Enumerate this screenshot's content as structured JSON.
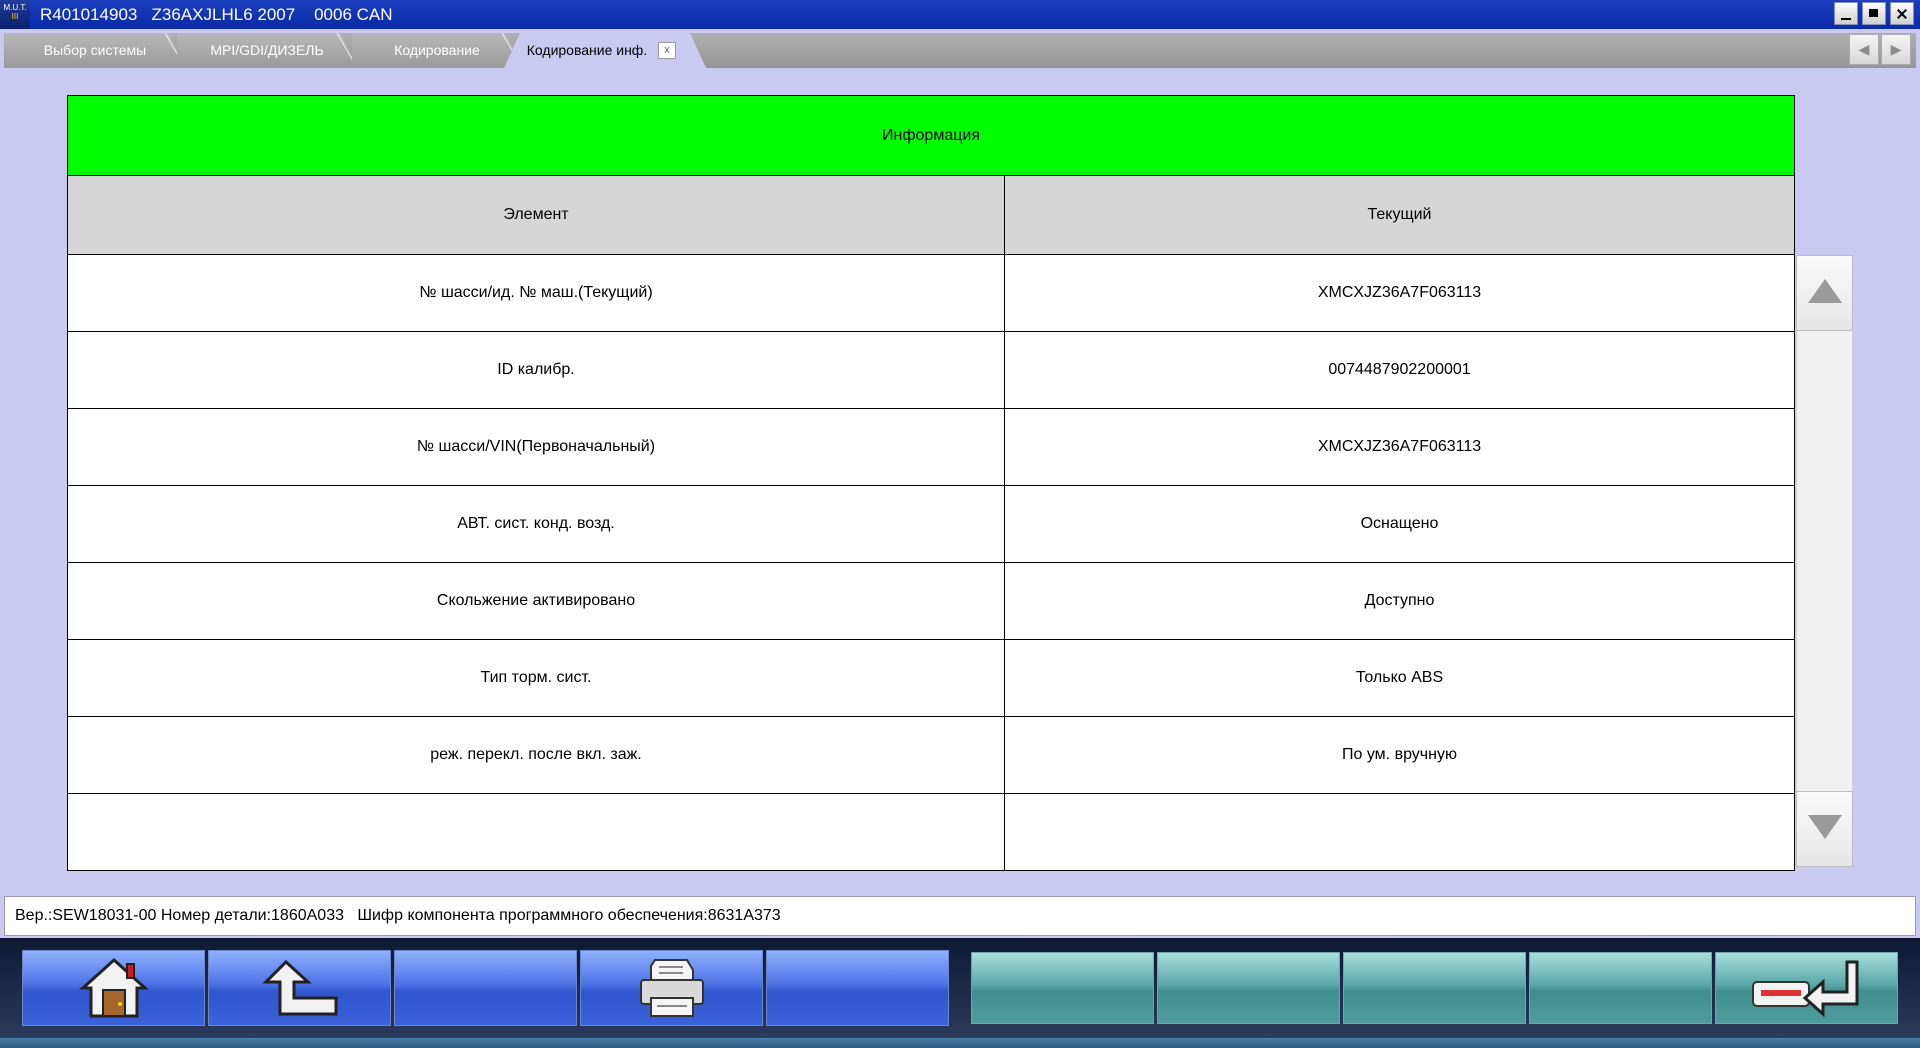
{
  "window": {
    "logo_top": "M.U.T.",
    "logo_bottom": "III",
    "title": "R401014903   Z36AXJLHL6 2007    0006 CAN"
  },
  "tabs": [
    {
      "label": "Выбор системы"
    },
    {
      "label": "MPI/GDI/ДИЗЕЛЬ"
    },
    {
      "label": "Кодирование"
    },
    {
      "label": "Кодирование инф."
    }
  ],
  "tab_close_label": "x",
  "tabnav": {
    "prev": "◀",
    "next": "▶"
  },
  "table": {
    "title": "Информация",
    "headers": [
      "Элемент",
      "Текущий"
    ],
    "rows": [
      [
        "№ шасси/ид. № маш.(Текущий)",
        "XMCXJZ36A7F063113"
      ],
      [
        "ID калибр.",
        "0074487902200001"
      ],
      [
        "№ шасси/VIN(Первоначальный)",
        "XMCXJZ36A7F063113"
      ],
      [
        "АВТ. сист. конд. возд.",
        "Оснащено"
      ],
      [
        "Скольжение активировано",
        "Доступно"
      ],
      [
        "Тип торм. сист.",
        "Только ABS"
      ],
      [
        "реж. перекл. после вкл. заж.",
        "По ум. вручную"
      ],
      [
        "",
        ""
      ]
    ]
  },
  "status_line": "Вер.:SEW18031-00 Номер детали:1860A033   Шифр компонента программного обеспечения:8631A373",
  "colors": {
    "header_green": "#00ff00",
    "background": "#c9c9f2",
    "title_bar": "#0a2aa6"
  }
}
